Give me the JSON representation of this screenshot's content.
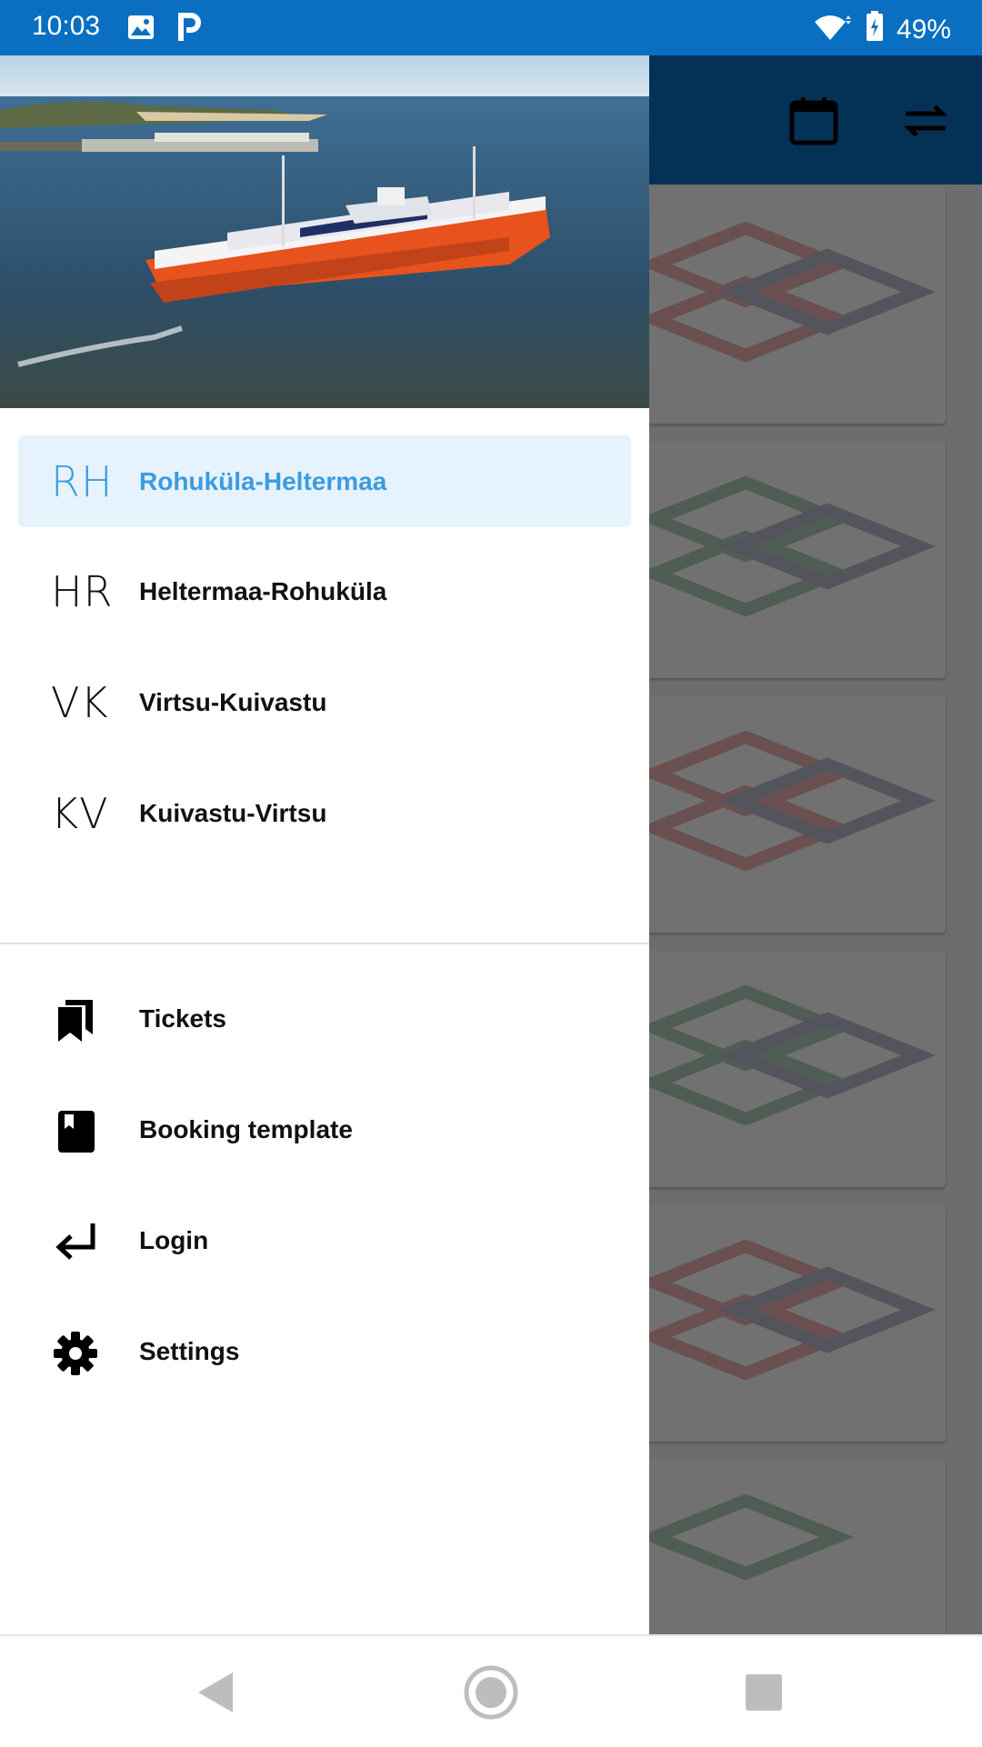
{
  "status_bar": {
    "time": "10:03",
    "icons": [
      "image-icon",
      "parking-icon",
      "wifi-icon",
      "battery-icon"
    ],
    "battery": "49%"
  },
  "toolbar": {
    "icons": [
      "calendar-icon",
      "swap-icon"
    ]
  },
  "drawer": {
    "routes": [
      {
        "code": "RH",
        "label": "Rohuküla-Heltermaa",
        "active": true
      },
      {
        "code": "HR",
        "label": "Heltermaa-Rohuküla",
        "active": false
      },
      {
        "code": "VK",
        "label": "Virtsu-Kuivastu",
        "active": false
      },
      {
        "code": "KV",
        "label": "Kuivastu-Virtsu",
        "active": false
      }
    ],
    "menu": [
      {
        "label": "Tickets",
        "icon": "tickets-icon"
      },
      {
        "label": "Booking template",
        "icon": "booking-template-icon"
      },
      {
        "label": "Login",
        "icon": "login-icon"
      },
      {
        "label": "Settings",
        "icon": "settings-icon"
      }
    ]
  },
  "nav_bar": {
    "buttons": [
      "back-icon",
      "home-icon",
      "recents-icon"
    ]
  },
  "colors": {
    "primary": "#0a6fc1",
    "active_text": "#3d9be0",
    "active_bg": "#e6f3fd"
  }
}
